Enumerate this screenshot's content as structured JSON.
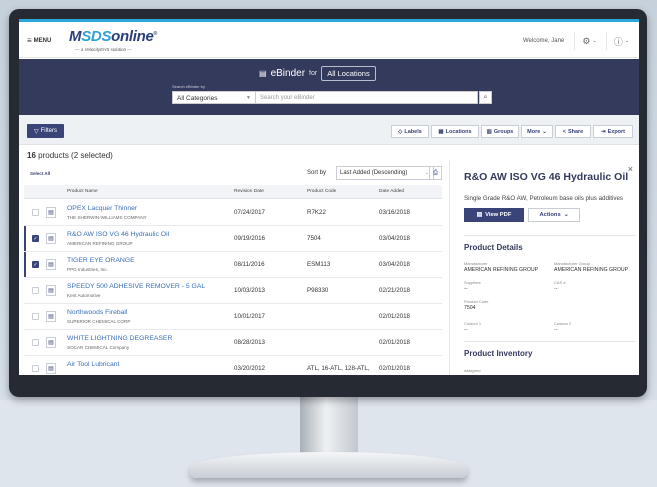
{
  "header": {
    "menu_label": "MENU",
    "logo_prefix": "M",
    "logo_sds": "SDS",
    "logo_suffix": "online",
    "tagline": "— a VelocityEHS solution —",
    "welcome": "Welcome, Jane"
  },
  "search": {
    "title": "eBinder",
    "for": "for",
    "location": "All Locations",
    "label": "Search eBinder by",
    "category": "All Categories",
    "placeholder": "Search your eBinder"
  },
  "toolbar": {
    "filters": "Filters",
    "labels": "Labels",
    "locations": "Locations",
    "groups": "Groups",
    "more": "More",
    "share": "Share",
    "export": "Export"
  },
  "count": {
    "number": "16",
    "text": "products (2 selected)"
  },
  "list": {
    "select_all": "Select All",
    "sort_by": "Sort by",
    "sort_value": "Last Added (Descending)",
    "columns": [
      "Product Name",
      "Revision Date",
      "Product Code",
      "Date Added"
    ],
    "rows": [
      {
        "name": "OPEX Lacquer Thinner",
        "mfr": "THE SHERWIN-WILLIAMS COMPANY",
        "rev": "07/24/2017",
        "code": "R7K22",
        "added": "03/16/2018",
        "selected": false
      },
      {
        "name": "R&O AW ISO VG 46 Hydraulic Oil",
        "mfr": "AMERICAN REFINING GROUP",
        "rev": "09/19/2016",
        "code": "7504",
        "added": "03/04/2018",
        "selected": true
      },
      {
        "name": "TIGER EYE ORANGE",
        "mfr": "PPG Industries, Inc.",
        "rev": "08/11/2016",
        "code": "ESM113",
        "added": "03/04/2018",
        "selected": true
      },
      {
        "name": "SPEEDY 500 ADHESIVE REMOVER - 5 GAL",
        "mfr": "Kent Automotive",
        "rev": "10/03/2013",
        "code": "P98330",
        "added": "02/21/2018",
        "selected": false
      },
      {
        "name": "Northwoods Fireball",
        "mfr": "SUPERIOR CHEMICAL CORP",
        "rev": "10/01/2017",
        "code": "",
        "added": "02/01/2018",
        "selected": false
      },
      {
        "name": "WHITE LIGHTNING DEGREASER",
        "mfr": "SOCAR CHEMICAL Company",
        "rev": "08/28/2013",
        "code": "",
        "added": "02/01/2018",
        "selected": false
      },
      {
        "name": "Air Tool Lubricant",
        "mfr": "",
        "rev": "03/20/2012",
        "code": "ATL, 16-ATL, 128-ATL,",
        "added": "02/01/2018",
        "selected": false
      }
    ]
  },
  "detail": {
    "title": "R&O AW ISO VG 46 Hydraulic Oil",
    "description": "Single Grade R&O AW, Petroleum base oils plus additives",
    "view_pdf": "View PDF",
    "actions": "Actions",
    "section_details": "Product Details",
    "manufacturer_label": "Manufacturer",
    "manufacturer_value": "AMERICAN REFINING GROUP",
    "mfr_group_label": "Manufacturer Group",
    "mfr_group_value": "AMERICAN REFINING GROUP",
    "suppliers_label": "Suppliers",
    "suppliers_value": "--",
    "cas_label": "CAS #",
    "cas_value": "--",
    "code_label": "Product Code",
    "code_value": "7504",
    "custom1_label": "Custom 1",
    "custom1_value": "--",
    "custom2_label": "Custom 2",
    "custom2_value": "--",
    "section_inventory": "Product Inventory",
    "assigned_label": "Assigned"
  }
}
